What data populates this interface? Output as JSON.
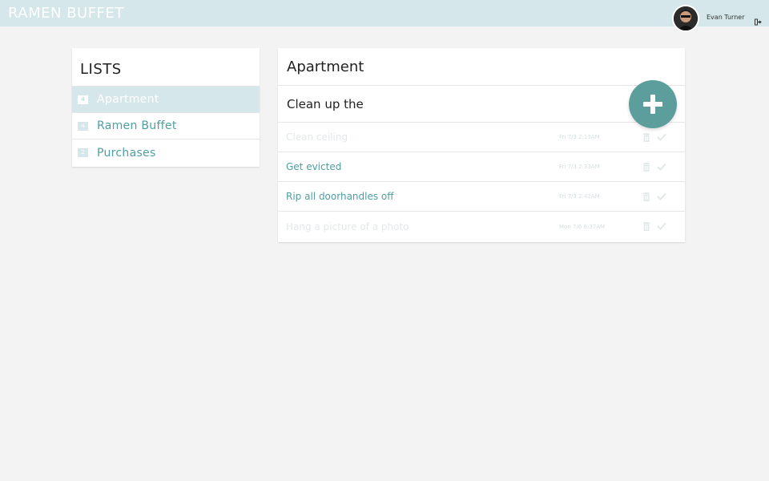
{
  "header": {
    "brand": "RAMEN BUFFET",
    "user_name": "Evan Turner"
  },
  "sidebar": {
    "title": "LISTS",
    "items": [
      {
        "count": "4",
        "label": "Apartment",
        "active": true
      },
      {
        "count": "4",
        "label": "Ramen Buffet",
        "active": false
      },
      {
        "count": "2",
        "label": "Purchases",
        "active": false
      }
    ]
  },
  "main": {
    "title": "Apartment",
    "new_task_value": "Clean up the",
    "tasks": [
      {
        "text": "Clean ceiling",
        "time": "Fri 7/3 2:13AM",
        "done": true
      },
      {
        "text": "Get evicted",
        "time": "Fri 7/3 2:33AM",
        "done": false
      },
      {
        "text": "Rip all doorhandles off",
        "time": "Fri 7/3 2:42AM",
        "done": false
      },
      {
        "text": "Hang a picture of a photo",
        "time": "Mon 7/6 6:37AM",
        "done": true
      }
    ]
  },
  "colors": {
    "header_bg": "#d5e7ea",
    "accent": "#5c9e9c",
    "link_text": "#4f9ea1",
    "page_bg": "#f3f3f3"
  },
  "icons": {
    "add": "plus-icon",
    "logout": "logout-icon",
    "delete": "trash-icon",
    "complete": "check-icon"
  }
}
